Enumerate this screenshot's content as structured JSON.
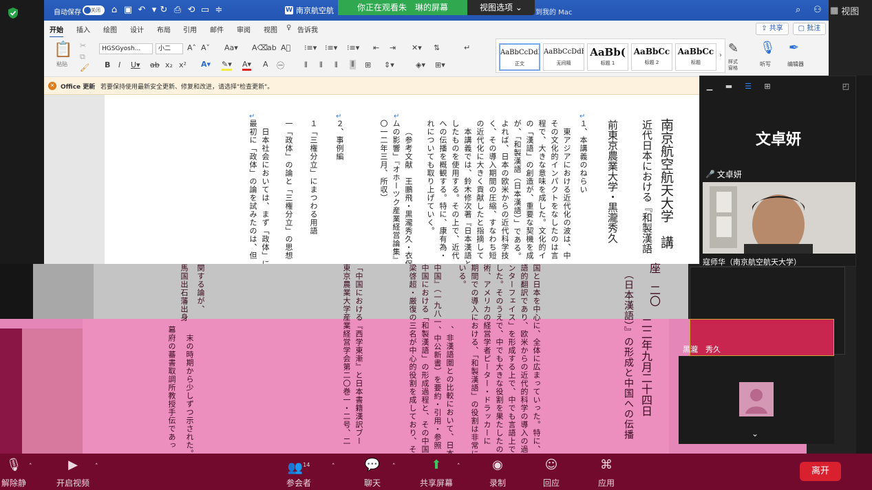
{
  "zoom": {
    "view_label": "视图",
    "share_banner": "你正在观看朱　琳的屏幕",
    "view_options": "视图选项",
    "speaker_name": "文卓妍",
    "speaker_tag": "文卓妍",
    "participant2": "黑瀧　秀久",
    "participant_row_label": "寇师华（南京航空航天大学）",
    "participants_count": "14",
    "toolbar": {
      "mute": "解除静音",
      "video": "开启视频",
      "participants": "参会者",
      "chat": "聊天",
      "share": "共享屏幕",
      "record": "录制",
      "reactions": "回应",
      "apps": "应用",
      "leave": "离开"
    },
    "colors": {
      "banner_green": "#2fa84f",
      "toolbar_bg": "#720a2e",
      "leave_red": "#d8202f"
    }
  },
  "word": {
    "autosave_label": "自动保存",
    "autosave_state": "关闭",
    "doc_title": "南京航空航",
    "save_location": "到我的 Mac",
    "menu_tabs": [
      "开始",
      "插入",
      "绘图",
      "设计",
      "布局",
      "引用",
      "邮件",
      "审阅",
      "视图"
    ],
    "tell_me": "告诉我",
    "share_label": "共享",
    "comment_label": "批注",
    "paste_label": "粘贴",
    "font_name": "HGSGyosh...",
    "font_size": "小二",
    "styles": [
      {
        "sample": "AaBbCcDdE",
        "label": "正文"
      },
      {
        "sample": "AaBbCcDdE",
        "label": "无间隔"
      },
      {
        "sample": "AaBb(",
        "label": "标题 1"
      },
      {
        "sample": "AaBbCc",
        "label": "标题 2"
      },
      {
        "sample": "AaBbCc",
        "label": "标题"
      }
    ],
    "styles_pane": "样式\n窗格",
    "dictate": "听写",
    "editor": "编辑器",
    "info_title": "Office 更新",
    "info_text": "若要保持使用最新安全更新、修复和改进，请选择\"检查更新\"。",
    "doc_columns": [
      "南京航空航天大学　講",
      "近代日本における『和製漢語",
      "前東京農業大学・黒瀧秀久",
      "１、本講義のねらい",
      "東アジアにおける近代化の波は、中",
      "その文化的インパクトをなしたのは言",
      "程で、大きな意味を成した。文化的イ",
      "の「漢語」の創造が、重要な契機を成",
      "が、「和製漢語（日本漢語）」である。",
      "よれば、日本の欧米からの近代科学技",
      "く、その導入期間の圧縮、すなわち短",
      "の近代化に大きく貢献したと指摘して",
      "本講義では、鈴木修次著『日本漢語と",
      "したものを使用する。その上で、近代",
      "への伝播を概観する。特に、康有為・",
      "れについても取り上げていく。",
      "（参考文献　王鵬飛・黒瀧秀久・衣保中",
      "ムの影響」『オホーツク産業経営論集』",
      "〇一二年三月、所収）",
      "２、事例編",
      "１「三権分立」にまつわる用語",
      "一「政体」の論と「三権分立」の思想",
      "日本社会においては、まず「政体」に",
      "最初に「政体」の論を試みたのは、但"
    ],
    "lower_columns": [
      "座　二〇",
      "（日本漢語）』の形成と中国への伝播",
      "二二年九月二十四日",
      "国と日本を中心に、全体に広まっていった。特に、",
      "語的翻訳であり、欧米からの近代的科学の導入の過",
      "ンターフェイス」を形成する上で、中でも言語上で",
      "した。そのうえで、中でも大きな役割を果たしたの",
      "術、アメリカの経営学者ピーター・ドラッカーに",
      "期間での導入における、「和製漢語」の役割は非常に大き",
      "いる。",
      "中国』（一九八一、中公新書）を要約・引用・参照",
      "中国における「和製漢語」の形成過程と、その中国",
      "梁啓超・厳復の三名が中心的役割を成しており、そ",
      "、非漢語圏との比較において、日本",
      "「中国における『西学東漸』と日本書籍漢訳ブー",
      "東京農業大学産業経営学会第二〇巻一・二号、二",
      "関する論が、",
      "馬国出石藩出身",
      "幕府の蕃書取調所教授手伝であっ",
      "末の時期から少しずつ示された。"
    ]
  }
}
